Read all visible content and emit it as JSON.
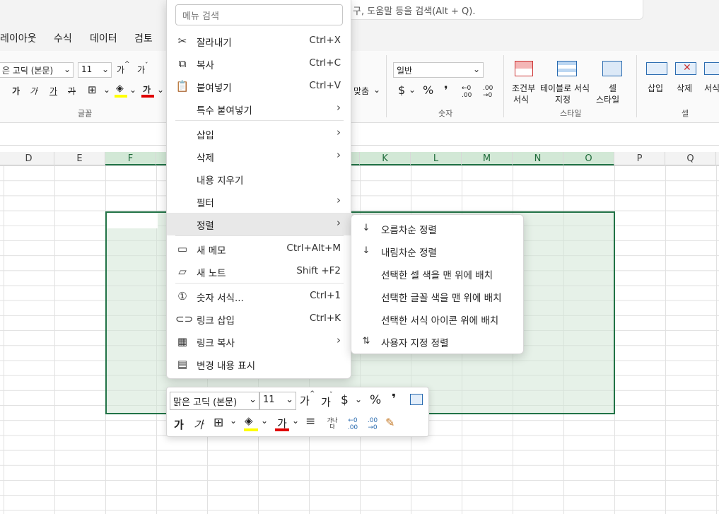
{
  "app": {
    "search_text": "구, 도움말 등을 검색(Alt + Q)."
  },
  "tabs": [
    "레이아웃",
    "수식",
    "데이터",
    "검토"
  ],
  "ribbon": {
    "font_name": "은 고딕 (본문)",
    "font_size": "11",
    "grow_font": "가",
    "shrink_font": "가",
    "bold": "가",
    "italic": "가",
    "underline": "가",
    "strike": "가",
    "font_color": "가",
    "wrap_label": "맞춤",
    "font_group": "글꼴",
    "number_format": "일반",
    "currency": "$",
    "percent": "%",
    "comma": "❜",
    "dec_inc": "←0 .00",
    "dec_dec": ".00 →0",
    "number_group": "숫자",
    "cond_format": [
      "조건부",
      "서식"
    ],
    "table_format": [
      "테이블로 서식",
      "지정"
    ],
    "cell_style": [
      "셀",
      "스타일"
    ],
    "style_group": "스타일",
    "insert": "삽입",
    "delete": "삭제",
    "format": "서식",
    "cell_group": "셀"
  },
  "columns": [
    {
      "label": "D",
      "selected": false
    },
    {
      "label": "E",
      "selected": false
    },
    {
      "label": "F",
      "selected": true
    },
    {
      "label": "",
      "selected": true
    },
    {
      "label": "",
      "selected": true
    },
    {
      "label": "",
      "selected": true
    },
    {
      "label": "",
      "selected": true
    },
    {
      "label": "K",
      "selected": true
    },
    {
      "label": "L",
      "selected": true
    },
    {
      "label": "M",
      "selected": true
    },
    {
      "label": "N",
      "selected": true
    },
    {
      "label": "O",
      "selected": true
    },
    {
      "label": "P",
      "selected": false
    },
    {
      "label": "Q",
      "selected": false
    }
  ],
  "context_menu": {
    "search_placeholder": "메뉴 검색",
    "items": [
      {
        "icon": "scissors-icon",
        "label": "잘라내기",
        "shortcut": "Ctrl+X"
      },
      {
        "icon": "copy-icon",
        "label": "복사",
        "shortcut": "Ctrl+C"
      },
      {
        "icon": "paste-icon",
        "label": "붙여넣기",
        "shortcut": "Ctrl+V"
      },
      {
        "icon": "",
        "label": "특수 붙여넣기",
        "submenu": true
      },
      {
        "icon": "",
        "label": "삽입",
        "submenu": true
      },
      {
        "icon": "",
        "label": "삭제",
        "submenu": true
      },
      {
        "icon": "",
        "label": "내용 지우기"
      },
      {
        "icon": "",
        "label": "필터",
        "submenu": true
      },
      {
        "icon": "",
        "label": "정렬",
        "submenu": true,
        "highlighted": true
      },
      {
        "icon": "new-comment-icon",
        "label": "새 메모",
        "shortcut": "Ctrl+Alt+M"
      },
      {
        "icon": "new-note-icon",
        "label": "새 노트",
        "shortcut": "Shift +F2"
      },
      {
        "icon": "number-format-icon",
        "label": "숫자 서식...",
        "shortcut": "Ctrl+1"
      },
      {
        "icon": "link-icon",
        "label": "링크 삽입",
        "shortcut": "Ctrl+K"
      },
      {
        "icon": "link-copy-icon",
        "label": "링크 복사",
        "submenu": true
      },
      {
        "icon": "show-changes-icon",
        "label": "변경 내용 표시"
      }
    ]
  },
  "sort_submenu": {
    "items": [
      {
        "icon": "sort-ascending-icon",
        "label": "오름차순 정렬"
      },
      {
        "icon": "sort-descending-icon",
        "label": "내림차순 정렬"
      },
      {
        "icon": "",
        "label": "선택한 셀 색을 맨 위에 배치"
      },
      {
        "icon": "",
        "label": "선택한 글꼴 색을 맨 위에 배치"
      },
      {
        "icon": "",
        "label": "선택한 서식 아이콘 위에 배치"
      },
      {
        "icon": "custom-sort-icon",
        "label": "사용자 지정 정렬"
      }
    ]
  },
  "mini_toolbar": {
    "font_name": "맑은 고딕 (본문)",
    "font_size": "11",
    "grow_font": "가",
    "shrink_font": "가",
    "currency": "$",
    "percent": "%",
    "comma": "❜",
    "bold": "가",
    "italic": "가",
    "font_color": "가",
    "wrap_text": "가나다"
  },
  "colors": {
    "selection_border": "#217346",
    "selection_fill": "#d1e6d6",
    "highlight_yellow": "#ffff00",
    "font_red": "#e00000"
  }
}
